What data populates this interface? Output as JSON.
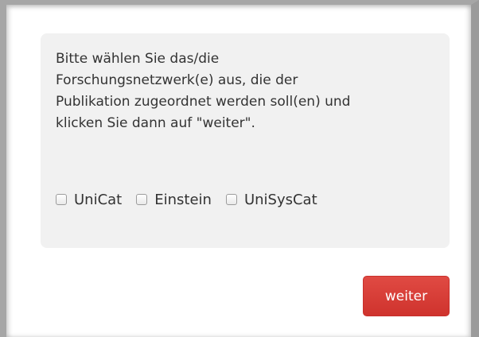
{
  "dialog": {
    "instruction_lines": [
      "Bitte wählen Sie das/die",
      "Forschungsnetzwerk(e) aus, die der",
      "Publikation zugeordnet werden soll(en) und",
      "klicken Sie dann auf \"weiter\"."
    ],
    "options": [
      {
        "label": "UniCat",
        "checked": false
      },
      {
        "label": "Einstein",
        "checked": false
      },
      {
        "label": "UniSysCat",
        "checked": false
      }
    ],
    "submit_label": "weiter"
  },
  "colors": {
    "panel_background": "#f1f1f1",
    "button_background": "#d9413b",
    "text": "#333333"
  }
}
